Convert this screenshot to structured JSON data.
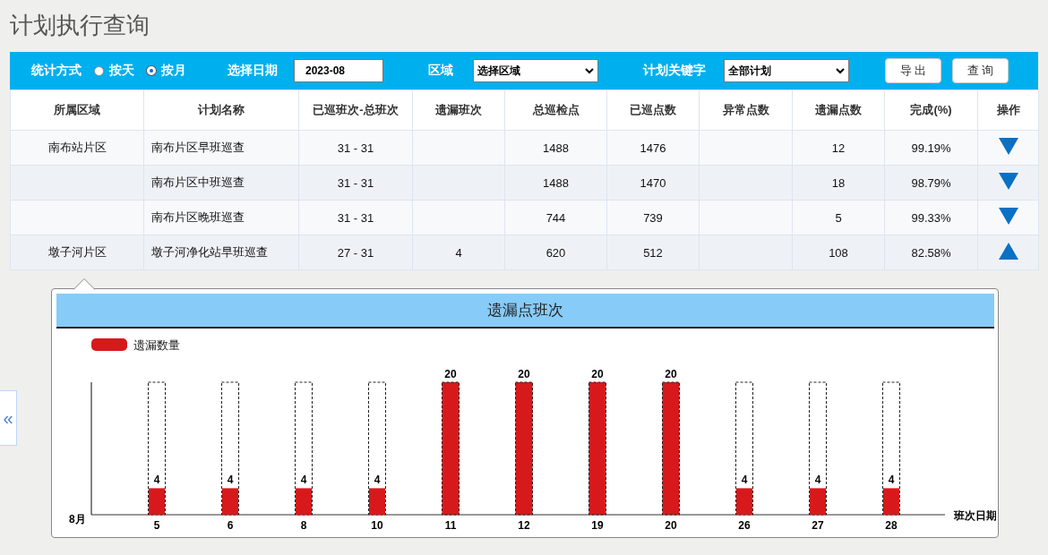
{
  "page_title": "计划执行查询",
  "toolbar": {
    "stat_label": "统计方式",
    "modes": [
      {
        "label": "按天",
        "selected": false
      },
      {
        "label": "按月",
        "selected": true
      }
    ],
    "date_label": "选择日期",
    "date_value": "2023-08",
    "area_label": "区域",
    "area_value": "选择区域",
    "keyword_label": "计划关键字",
    "keyword_value": "全部计划",
    "buttons": [
      "导 出",
      "查 询"
    ]
  },
  "table": {
    "columns": [
      "所属区域",
      "计划名称",
      "已巡班次-总班次",
      "遗漏班次",
      "总巡检点",
      "已巡点数",
      "异常点数",
      "遗漏点数",
      "完成(%)",
      "操作"
    ],
    "rows": [
      {
        "area": "南布站片区",
        "plan": "南布片区早班巡查",
        "shifts": "31 - 31",
        "total_points": "1488",
        "patrolled_points": "1476",
        "missed_points": "12",
        "completion": "99.19%",
        "expanded": false
      },
      {
        "plan": "南布片区中班巡查",
        "shifts": "31 - 31",
        "total_points": "1488",
        "patrolled_points": "1470",
        "missed_points": "18",
        "completion": "98.79%",
        "expanded": false
      },
      {
        "plan": "南布片区晚班巡查",
        "shifts": "31 - 31",
        "total_points": "744",
        "patrolled_points": "739",
        "missed_points": "5",
        "completion": "99.33%",
        "expanded": false
      },
      {
        "area": "墩子河片区",
        "plan": "墩子河净化站早班巡查",
        "shifts": "27 - 31",
        "missed_shifts": "4",
        "total_points": "620",
        "patrolled_points": "512",
        "missed_points": "108",
        "completion": "82.58%",
        "expanded": true
      }
    ]
  },
  "detail": {
    "title": "遗漏点班次",
    "month_label": "8月",
    "chart_data": {
      "type": "bar",
      "xlabel": "班次日期",
      "categories": [
        "5",
        "6",
        "8",
        "10",
        "11",
        "12",
        "19",
        "20",
        "26",
        "27",
        "28"
      ],
      "ylim": [
        0,
        20
      ],
      "data_labels": true,
      "series": [
        {
          "name": "遗漏数量",
          "color": "#d7191c",
          "values": [
            4,
            4,
            4,
            4,
            20,
            20,
            20,
            20,
            4,
            4,
            4
          ]
        }
      ]
    }
  },
  "collapse_tab": "«"
}
